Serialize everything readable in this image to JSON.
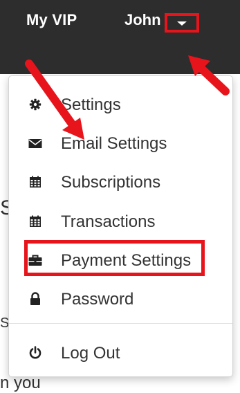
{
  "topbar": {
    "brand_label": "My VIP",
    "user_label": "John",
    "caret_icon": "caret-down-icon",
    "background": "#2d2d2d"
  },
  "dropdown": {
    "items": [
      {
        "label": "Settings",
        "icon": "gear-icon"
      },
      {
        "label": "Email Settings",
        "icon": "envelope-icon"
      },
      {
        "label": "Subscriptions",
        "icon": "calendar-icon"
      },
      {
        "label": "Transactions",
        "icon": "calendar-icon"
      },
      {
        "label": "Payment Settings",
        "icon": "briefcase-icon"
      },
      {
        "label": "Password",
        "icon": "lock-icon"
      }
    ],
    "logout": {
      "label": "Log Out",
      "icon": "power-icon"
    }
  },
  "background_fragments": [
    "S",
    "S",
    "n you"
  ],
  "annotation": {
    "color": "#e8141c",
    "highlighted": [
      "caret-down-icon",
      "Subscriptions"
    ]
  }
}
